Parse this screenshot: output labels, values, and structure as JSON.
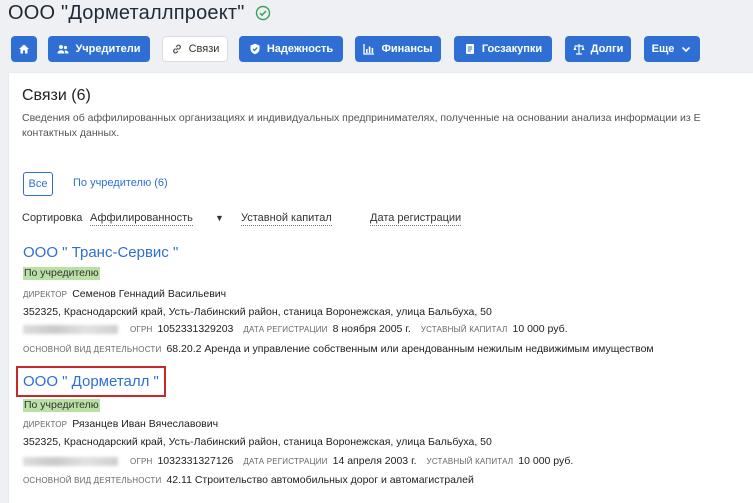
{
  "header": {
    "title": "ООО \"Дорметаллпроект\""
  },
  "nav": {
    "home_label": "",
    "founders": "Учредители",
    "links": "Связи",
    "reliability": "Надежность",
    "finance": "Финансы",
    "procurement": "Госзакупки",
    "debts": "Долги",
    "more": "Еще"
  },
  "section": {
    "title": "Связи (6)",
    "desc_line1": "Сведения об аффилированных организациях и индивидуальных предпринимателях, полученные на основании анализа информации из Е",
    "desc_line2": "контактных данных."
  },
  "filters": {
    "all": "Все",
    "by_founder": "По учредителю (6)"
  },
  "sort": {
    "label": "Сортировка",
    "affiliation": "Аффилированность",
    "caret": "▼",
    "capital": "Уставной капитал",
    "reg_date": "Дата регистрации"
  },
  "labels": {
    "director": "директор",
    "ogrn": "огрн",
    "reg_date": "дата регистрации",
    "capital": "уставный капитал",
    "activity": "основной вид деятельности"
  },
  "companies": [
    {
      "name": "ООО \" Транс-Сервис \"",
      "badge": "По учредителю",
      "director": "Семенов Геннадий Васильевич",
      "address": "352325, Краснодарский край, Усть-Лабинский район, станица Воронежская, улица Бальбуха, 50",
      "ogrn": "1052331329203",
      "reg_date": "8 ноября 2005 г.",
      "capital": "10 000 руб.",
      "activity": "68.20.2 Аренда и управление собственным или арендованным нежилым недвижимым имуществом"
    },
    {
      "name": "ООО \" Дорметалл \"",
      "badge": "По учредителю",
      "director": "Рязанцев Иван Вячеславович",
      "address": "352325, Краснодарский край, Усть-Лабинский район, станица Воронежская, улица Бальбуха, 50",
      "ogrn": "1032331327126",
      "reg_date": "14 апреля 2003 г.",
      "capital": "10 000 руб.",
      "activity": "42.11 Строительство автомобильных дорог и автомагистралей"
    }
  ]
}
